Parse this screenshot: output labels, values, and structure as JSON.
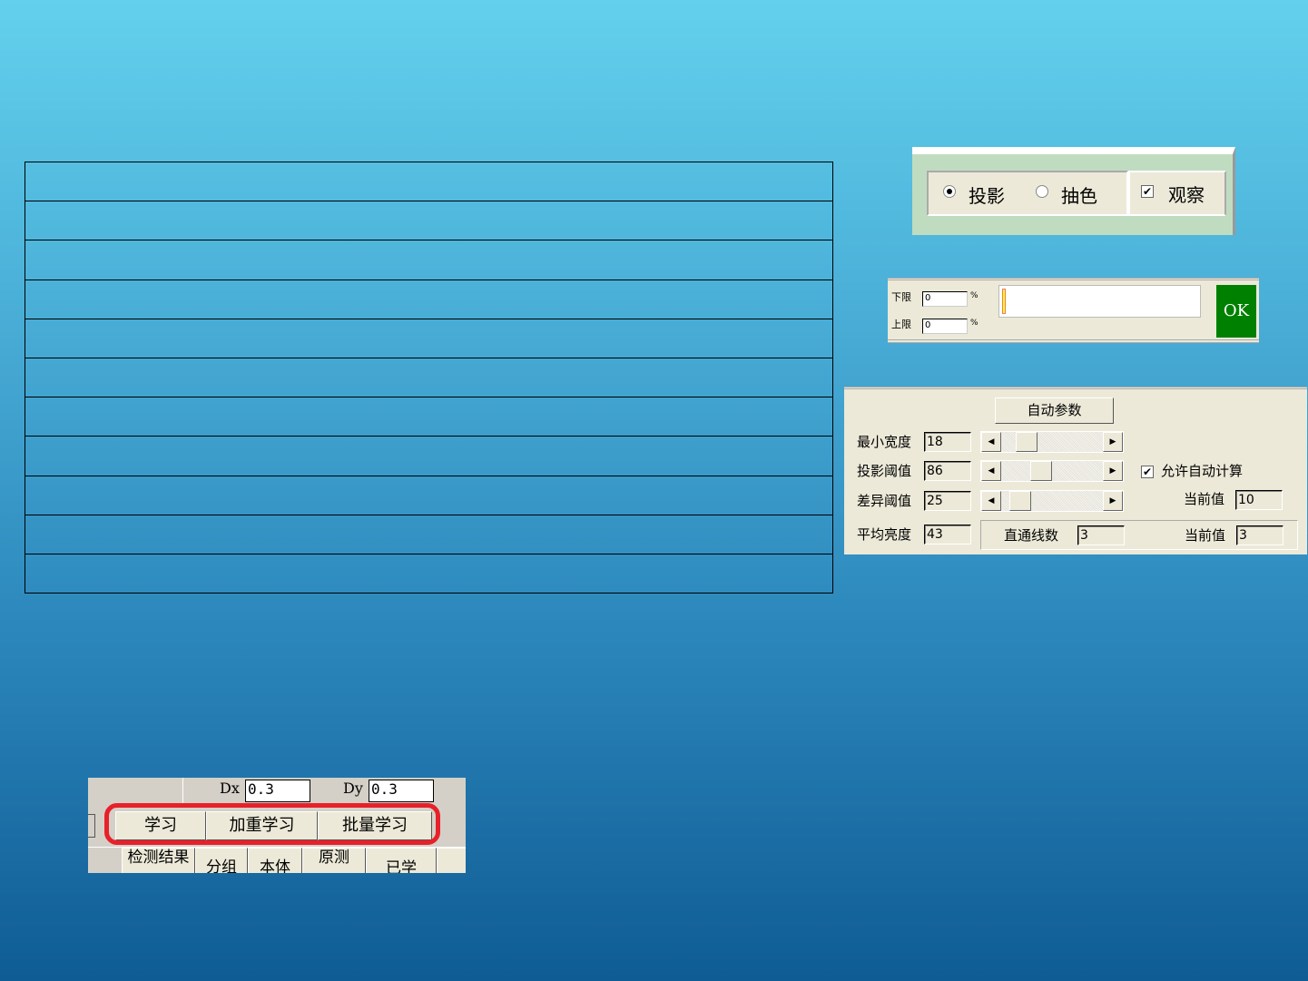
{
  "mode_panel": {
    "radio_projection": "投影",
    "radio_color": "抽色",
    "checkbox_observe": "观察",
    "selected": "投影",
    "observe_checked": true
  },
  "limit_panel": {
    "lower_label": "下限",
    "lower_value": "0",
    "upper_label": "上限",
    "upper_value": "0",
    "percent": "%",
    "ok_label": "OK"
  },
  "param_panel": {
    "auto_button": "自动参数",
    "rows": [
      {
        "label": "最小宽度",
        "value": "18",
        "slider": 0.2
      },
      {
        "label": "投影阈值",
        "value": "86",
        "slider": 0.4
      },
      {
        "label": "差异阈值",
        "value": "25",
        "slider": 0.15
      }
    ],
    "brightness_label": "平均亮度",
    "brightness_value": "43",
    "auto_calc_label": "允许自动计算",
    "auto_calc_checked": true,
    "current_label": "当前值",
    "current_value_1": "10",
    "lines_label": "直通线数",
    "lines_value": "3",
    "current_value_2": "3"
  },
  "learn_panel": {
    "dx_label": "Dx",
    "dx_value": "0.3",
    "dy_label": "Dy",
    "dy_value": "0.3",
    "buttons": [
      "学习",
      "加重学习",
      "批量学习"
    ],
    "columns": [
      "检测结果",
      "分组",
      "本体",
      "原测",
      "已学"
    ]
  },
  "colors": {
    "highlight": "#e8202a",
    "ok": "#008000"
  }
}
